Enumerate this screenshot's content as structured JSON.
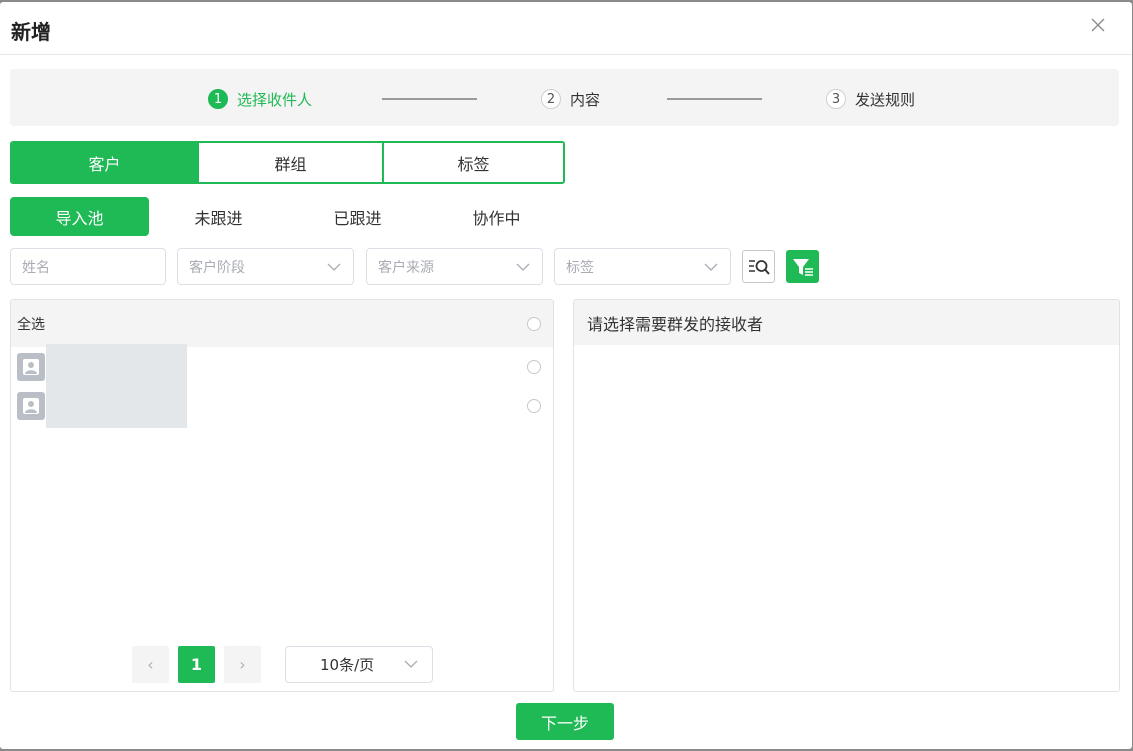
{
  "modal": {
    "title": "新增"
  },
  "steps": [
    {
      "num": "1",
      "label": "选择收件人"
    },
    {
      "num": "2",
      "label": "内容"
    },
    {
      "num": "3",
      "label": "发送规则"
    }
  ],
  "seg_tabs": [
    "客户",
    "群组",
    "标签"
  ],
  "sub_tabs": [
    "导入池",
    "未跟进",
    "已跟进",
    "协作中"
  ],
  "filters": {
    "name_placeholder": "姓名",
    "stage_placeholder": "客户阶段",
    "source_placeholder": "客户来源",
    "tag_placeholder": "标签"
  },
  "left_panel": {
    "select_all": "全选"
  },
  "right_panel": {
    "title": "请选择需要群发的接收者"
  },
  "pagination": {
    "prev": "‹",
    "current_page": "1",
    "next": "›",
    "page_size": "10条/页"
  },
  "footer": {
    "next_label": "下一步"
  },
  "colors": {
    "accent": "#1fb955"
  }
}
